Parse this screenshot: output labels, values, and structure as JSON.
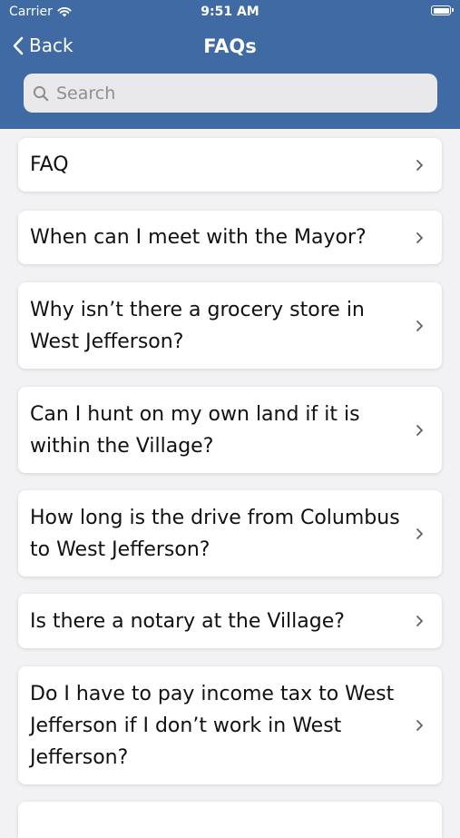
{
  "status_bar": {
    "carrier": "Carrier",
    "time": "9:51 AM"
  },
  "nav": {
    "back_label": "Back",
    "title": "FAQs"
  },
  "search": {
    "placeholder": "Search"
  },
  "faqs": [
    {
      "question": "FAQ"
    },
    {
      "question": "When can I meet with the Mayor?"
    },
    {
      "question": "Why isn’t there a grocery store in West Jefferson?"
    },
    {
      "question": "Can I hunt on my own land if it is within the Village?"
    },
    {
      "question": "How long is the drive from Columbus to West Jefferson?"
    },
    {
      "question": "Is there a notary at the Village?"
    },
    {
      "question": "Do I have to pay income tax to West Jefferson if I don’t work in West Jefferson?"
    },
    {
      "question": ""
    }
  ],
  "colors": {
    "header": "#3f6aa3",
    "background": "#f2f2f4",
    "card": "#ffffff"
  }
}
